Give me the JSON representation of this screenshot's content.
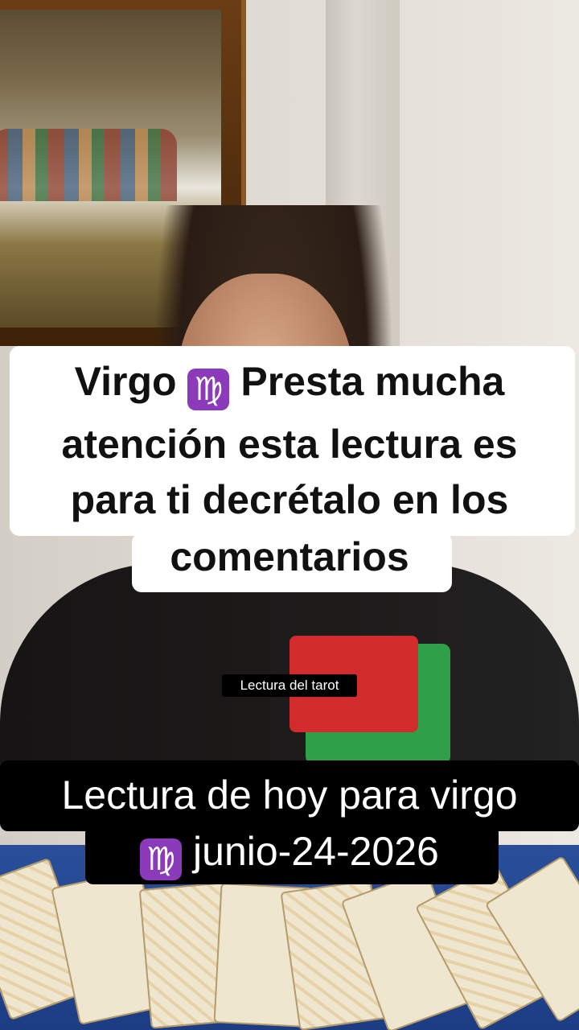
{
  "caption": {
    "line1_pre": "Virgo",
    "line1_post": "Presta mucha",
    "line2": "atención esta lectura es",
    "line3": "para ti decrétalo en los",
    "line4": "comentarios"
  },
  "zodiac_symbol": "♍",
  "center_label": "Lectura del tarot",
  "bottom_caption": {
    "line1": "Lectura de hoy para virgo",
    "line2": "junio-24-2026"
  },
  "colors": {
    "caption_bg": "#ffffff",
    "bottom_bg": "#000000",
    "zodiac_badge": "#8b3bb9",
    "tablecloth": "#2a4f9a"
  }
}
